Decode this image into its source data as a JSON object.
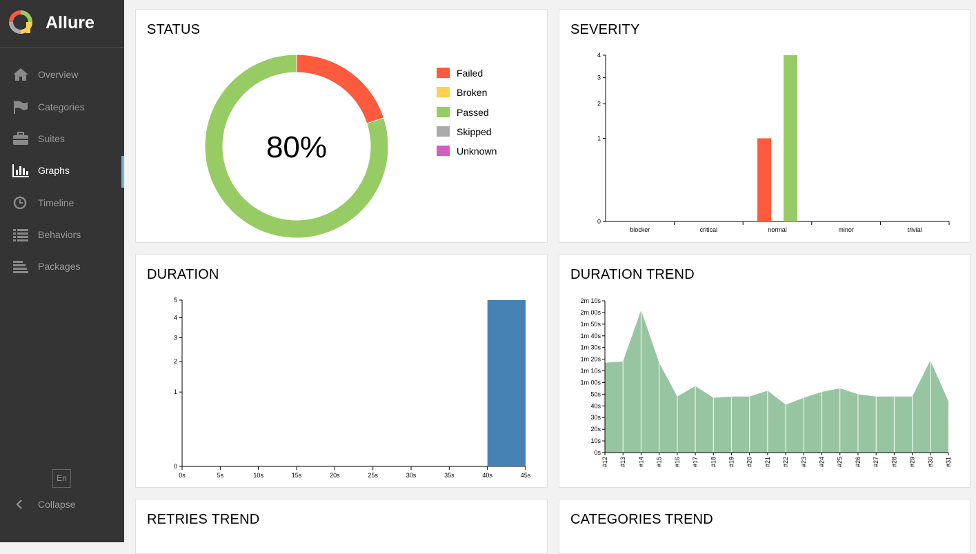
{
  "app": {
    "name": "Allure"
  },
  "sidebar": {
    "items": [
      {
        "label": "Overview",
        "icon": "home-icon"
      },
      {
        "label": "Categories",
        "icon": "flag-icon"
      },
      {
        "label": "Suites",
        "icon": "briefcase-icon"
      },
      {
        "label": "Graphs",
        "icon": "bar-chart-icon",
        "active": true
      },
      {
        "label": "Timeline",
        "icon": "clock-icon"
      },
      {
        "label": "Behaviors",
        "icon": "list-icon"
      },
      {
        "label": "Packages",
        "icon": "align-left-icon"
      }
    ],
    "language": "En",
    "collapse_label": "Collapse"
  },
  "colors": {
    "failed": "#fd5a3e",
    "broken": "#ffd050",
    "passed": "#97cc64",
    "skipped": "#aaaaaa",
    "unknown": "#d35ebe",
    "duration": "#4682b4",
    "trend": "#98c5a1",
    "active_accent": "#6db1e2"
  },
  "cards": {
    "status": {
      "title": "STATUS"
    },
    "severity": {
      "title": "SEVERITY"
    },
    "duration": {
      "title": "DURATION"
    },
    "duration_trend": {
      "title": "DURATION TREND"
    },
    "retries_trend": {
      "title": "RETRIES TREND"
    },
    "categories_trend": {
      "title": "CATEGORIES TREND"
    }
  },
  "chart_data": [
    {
      "id": "status",
      "type": "pie",
      "title": "STATUS",
      "center_label": "80%",
      "legend": [
        "Failed",
        "Broken",
        "Passed",
        "Skipped",
        "Unknown"
      ],
      "slices": [
        {
          "name": "Failed",
          "value": 1
        },
        {
          "name": "Passed",
          "value": 4
        }
      ]
    },
    {
      "id": "severity",
      "type": "bar",
      "title": "SEVERITY",
      "categories": [
        "blocker",
        "critical",
        "normal",
        "minor",
        "trivial"
      ],
      "series": [
        {
          "name": "Failed",
          "values": [
            0,
            0,
            1,
            0,
            0
          ]
        },
        {
          "name": "Passed",
          "values": [
            0,
            0,
            4,
            0,
            0
          ]
        }
      ],
      "yticks": [
        0,
        1,
        2,
        3,
        4
      ],
      "ylim": [
        0,
        4
      ]
    },
    {
      "id": "duration",
      "type": "bar",
      "title": "DURATION",
      "xticks": [
        "0s",
        "5s",
        "10s",
        "15s",
        "20s",
        "25s",
        "30s",
        "35s",
        "40s",
        "45s"
      ],
      "bins": [
        {
          "from": 40,
          "to": 45,
          "value": 5
        }
      ],
      "xlim": [
        0,
        45
      ],
      "yticks": [
        0,
        1,
        2,
        3,
        4,
        5
      ],
      "ylim": [
        0,
        5
      ]
    },
    {
      "id": "duration_trend",
      "type": "area",
      "title": "DURATION TREND",
      "x": [
        "#12",
        "#13",
        "#14",
        "#15",
        "#16",
        "#17",
        "#18",
        "#19",
        "#20",
        "#21",
        "#22",
        "#23",
        "#24",
        "#25",
        "#26",
        "#27",
        "#28",
        "#29",
        "#30",
        "#31"
      ],
      "values": [
        77,
        78,
        122,
        77,
        48,
        57,
        47,
        48,
        48,
        53,
        41,
        47,
        52,
        55,
        50,
        48,
        48,
        48,
        79,
        44
      ],
      "yticks": [
        "0s",
        "10s",
        "20s",
        "30s",
        "40s",
        "50s",
        "1m 00s",
        "1m 10s",
        "1m 20s",
        "1m 30s",
        "1m 40s",
        "1m 50s",
        "2m 00s",
        "2m 10s"
      ],
      "ylim": [
        0,
        130
      ]
    }
  ]
}
